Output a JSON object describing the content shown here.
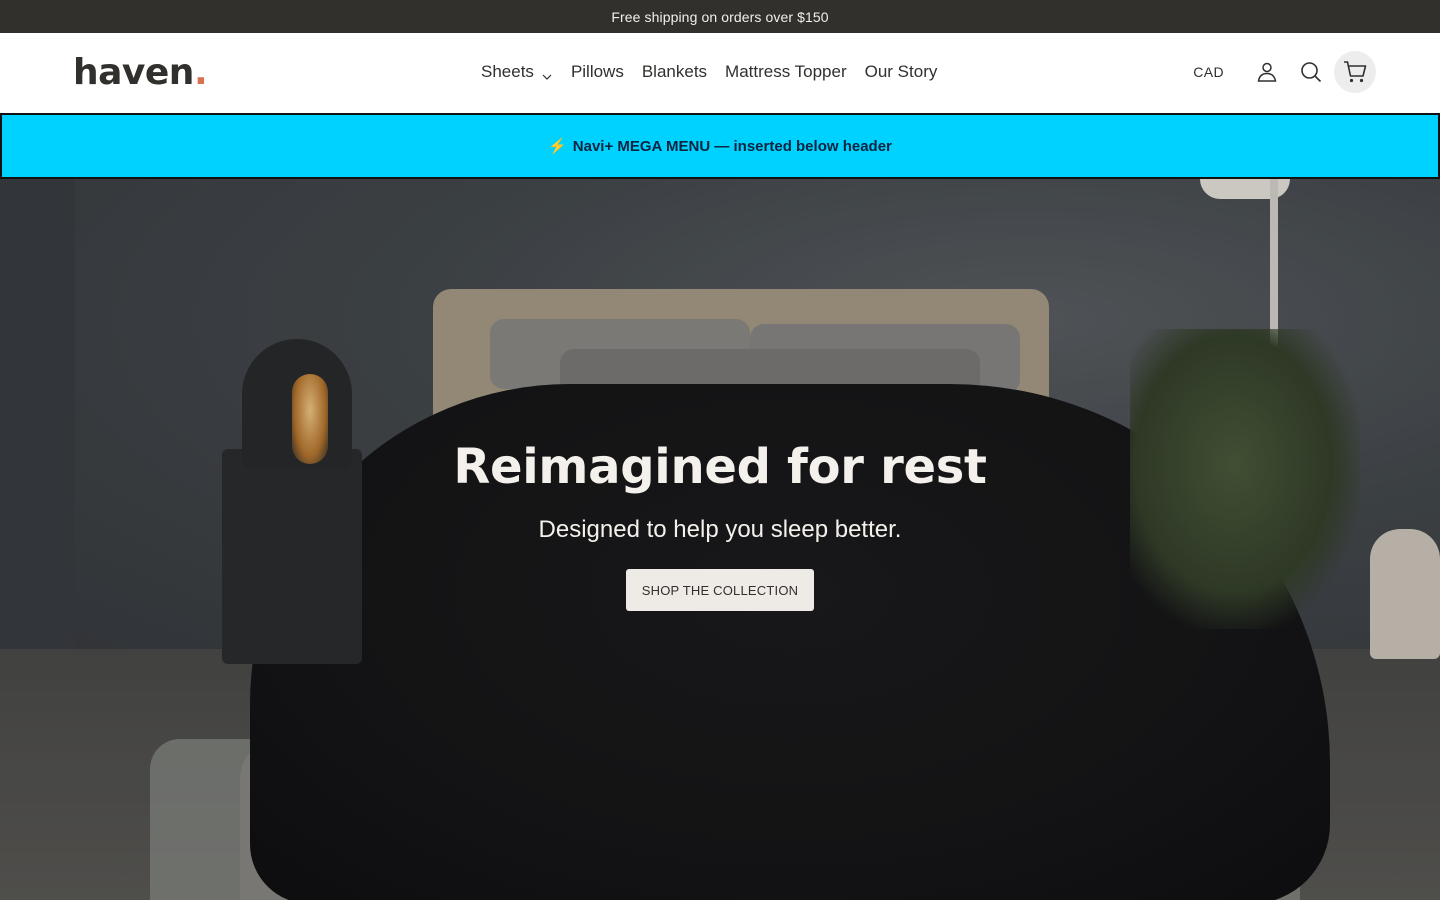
{
  "announcement": {
    "text": "Free shipping on orders over $150"
  },
  "header": {
    "logo_text": "haven",
    "logo_dot": ".",
    "nav": [
      {
        "label": "Sheets",
        "has_dropdown": true
      },
      {
        "label": "Pillows"
      },
      {
        "label": "Blankets"
      },
      {
        "label": "Mattress Topper"
      },
      {
        "label": "Our Story"
      }
    ],
    "currency": "CAD",
    "icons": [
      "account-icon",
      "search-icon",
      "cart-icon"
    ]
  },
  "mega_menu_banner": {
    "icon": "⚡",
    "text": "Navi+ MEGA MENU — inserted below header"
  },
  "hero": {
    "title": "Reimagined for rest",
    "subtitle": "Designed to help you sleep better.",
    "cta_label": "SHOP THE COLLECTION"
  },
  "colors": {
    "announcement_bg": "#32302d",
    "logo_dot": "#d9704f",
    "mega_bar_bg": "#00d2ff",
    "cta_bg": "#eeebe6"
  }
}
